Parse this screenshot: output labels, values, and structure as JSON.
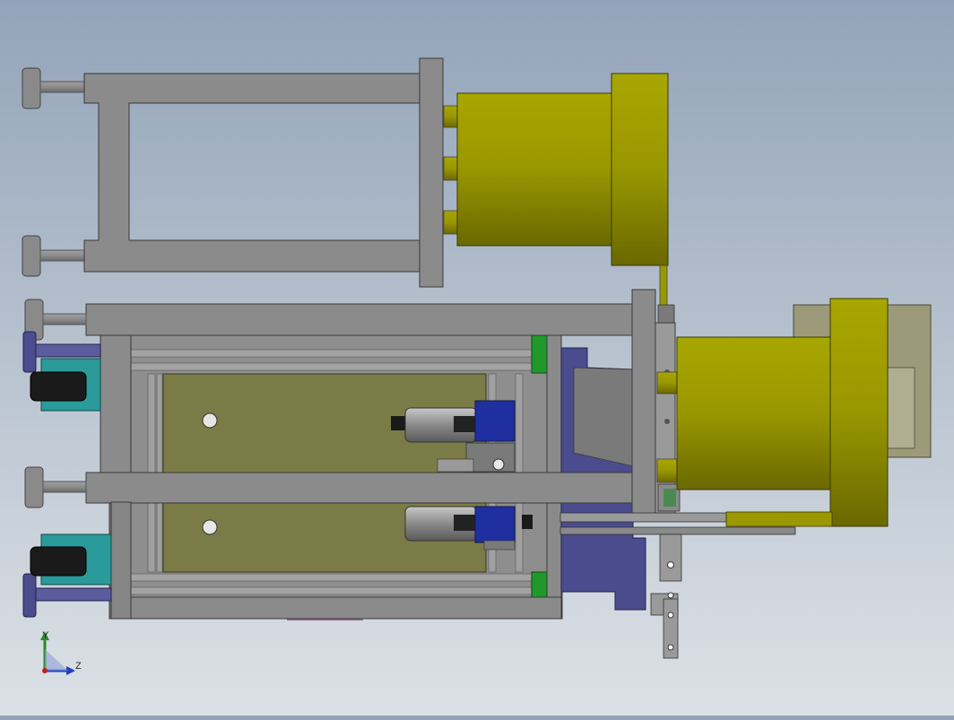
{
  "view": {
    "triad": {
      "y_label": "Y",
      "z_label": "Z"
    }
  },
  "colors": {
    "frame": "#8b8b8b",
    "frame_dark": "#6e6e6e",
    "cylinder_yellow": "#9a9800",
    "cylinder_dark": "#6f6d00",
    "panel_olive": "#7b7b47",
    "motor_blue": "#3d3f8c",
    "teal": "#2a9a9a",
    "green_block": "#1f9a2a",
    "tan_box": "#9c9a78"
  }
}
